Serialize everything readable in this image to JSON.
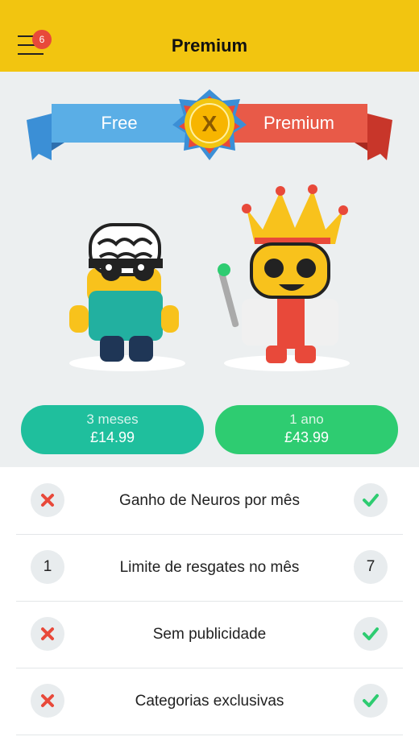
{
  "header": {
    "title": "Premium",
    "notifications": "6"
  },
  "banner": {
    "free": "Free",
    "premium": "Premium",
    "medal_letter": "X"
  },
  "plans": [
    {
      "duration": "3 meses",
      "price": "£14.99"
    },
    {
      "duration": "1 ano",
      "price": "£43.99"
    }
  ],
  "features": [
    {
      "label": "Ganho de Neuros por mês",
      "free": "cross-icon",
      "premium": "check-icon"
    },
    {
      "label": "Limite de resgates no mês",
      "free": "1",
      "premium": "7"
    },
    {
      "label": "Sem publicidade",
      "free": "cross-icon",
      "premium": "check-icon"
    },
    {
      "label": "Categorias exclusivas",
      "free": "cross-icon",
      "premium": "check-icon"
    }
  ],
  "colors": {
    "header": "#f2c510",
    "free_banner": "#5aaee6",
    "premium_banner": "#e85a48",
    "plan_3m": "#1fbf9d",
    "plan_1y": "#2ecc71",
    "cross": "#e8493a",
    "check": "#2ecc71"
  }
}
